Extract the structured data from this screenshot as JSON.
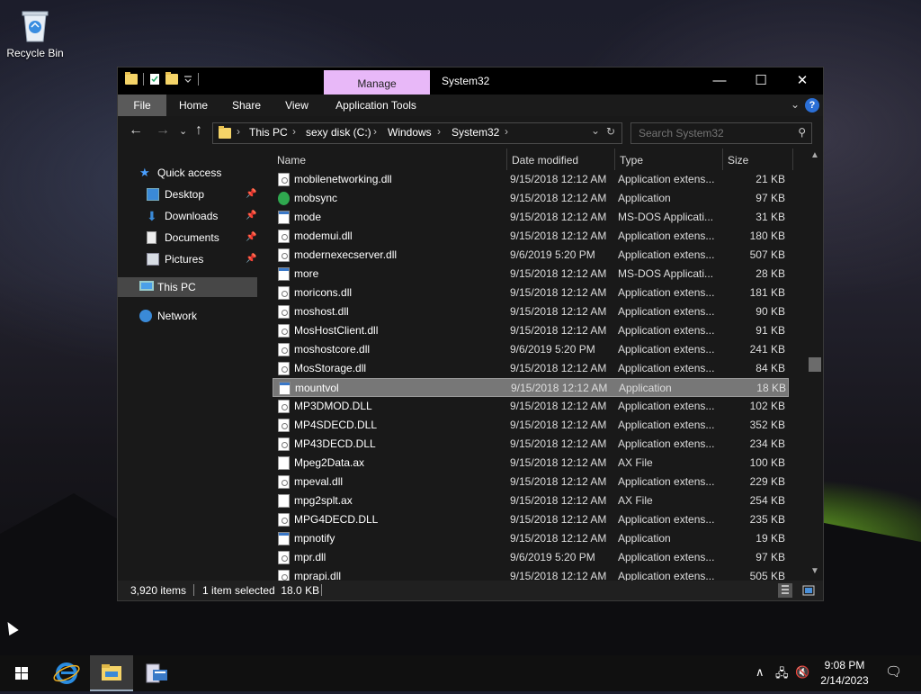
{
  "desktop": {
    "recycle_bin_label": "Recycle Bin"
  },
  "window": {
    "contextual_tab": "Manage",
    "title": "System32",
    "controls": {
      "minimize": "—",
      "maximize": "☐",
      "close": "✕"
    }
  },
  "ribbon": {
    "tabs": [
      "File",
      "Home",
      "Share",
      "View",
      "Application Tools"
    ]
  },
  "address": {
    "segments": [
      "This PC",
      "sexy disk (C:)",
      "Windows",
      "System32"
    ]
  },
  "search": {
    "placeholder": "Search System32"
  },
  "nav": {
    "items": [
      {
        "label": "Quick access",
        "icon": "star-icon"
      },
      {
        "label": "Desktop",
        "icon": "desktop-folder-icon",
        "pinned": true
      },
      {
        "label": "Downloads",
        "icon": "download-icon",
        "pinned": true
      },
      {
        "label": "Documents",
        "icon": "documents-icon",
        "pinned": true
      },
      {
        "label": "Pictures",
        "icon": "pictures-icon",
        "pinned": true
      },
      {
        "label": "This PC",
        "icon": "computer-icon",
        "selected": true
      },
      {
        "label": "Network",
        "icon": "network-icon"
      }
    ]
  },
  "columns": {
    "name": "Name",
    "date": "Date modified",
    "type": "Type",
    "size": "Size"
  },
  "files": [
    {
      "name": "mobilenetworking.dll",
      "date": "9/15/2018 12:12 AM",
      "type": "Application extens...",
      "size": "21 KB",
      "icon": "dll"
    },
    {
      "name": "mobsync",
      "date": "9/15/2018 12:12 AM",
      "type": "Application",
      "size": "97 KB",
      "icon": "sync"
    },
    {
      "name": "mode",
      "date": "9/15/2018 12:12 AM",
      "type": "MS-DOS Applicati...",
      "size": "31 KB",
      "icon": "app"
    },
    {
      "name": "modemui.dll",
      "date": "9/15/2018 12:12 AM",
      "type": "Application extens...",
      "size": "180 KB",
      "icon": "dll"
    },
    {
      "name": "modernexecserver.dll",
      "date": "9/6/2019 5:20 PM",
      "type": "Application extens...",
      "size": "507 KB",
      "icon": "dll"
    },
    {
      "name": "more",
      "date": "9/15/2018 12:12 AM",
      "type": "MS-DOS Applicati...",
      "size": "28 KB",
      "icon": "app"
    },
    {
      "name": "moricons.dll",
      "date": "9/15/2018 12:12 AM",
      "type": "Application extens...",
      "size": "181 KB",
      "icon": "dll"
    },
    {
      "name": "moshost.dll",
      "date": "9/15/2018 12:12 AM",
      "type": "Application extens...",
      "size": "90 KB",
      "icon": "dll"
    },
    {
      "name": "MosHostClient.dll",
      "date": "9/15/2018 12:12 AM",
      "type": "Application extens...",
      "size": "91 KB",
      "icon": "dll"
    },
    {
      "name": "moshostcore.dll",
      "date": "9/6/2019 5:20 PM",
      "type": "Application extens...",
      "size": "241 KB",
      "icon": "dll"
    },
    {
      "name": "MosStorage.dll",
      "date": "9/15/2018 12:12 AM",
      "type": "Application extens...",
      "size": "84 KB",
      "icon": "dll"
    },
    {
      "name": "mountvol",
      "date": "9/15/2018 12:12 AM",
      "type": "Application",
      "size": "18 KB",
      "icon": "app",
      "selected": true
    },
    {
      "name": "MP3DMOD.DLL",
      "date": "9/15/2018 12:12 AM",
      "type": "Application extens...",
      "size": "102 KB",
      "icon": "dll"
    },
    {
      "name": "MP4SDECD.DLL",
      "date": "9/15/2018 12:12 AM",
      "type": "Application extens...",
      "size": "352 KB",
      "icon": "dll"
    },
    {
      "name": "MP43DECD.DLL",
      "date": "9/15/2018 12:12 AM",
      "type": "Application extens...",
      "size": "234 KB",
      "icon": "dll"
    },
    {
      "name": "Mpeg2Data.ax",
      "date": "9/15/2018 12:12 AM",
      "type": "AX File",
      "size": "100 KB",
      "icon": "ax"
    },
    {
      "name": "mpeval.dll",
      "date": "9/15/2018 12:12 AM",
      "type": "Application extens...",
      "size": "229 KB",
      "icon": "dll"
    },
    {
      "name": "mpg2splt.ax",
      "date": "9/15/2018 12:12 AM",
      "type": "AX File",
      "size": "254 KB",
      "icon": "ax"
    },
    {
      "name": "MPG4DECD.DLL",
      "date": "9/15/2018 12:12 AM",
      "type": "Application extens...",
      "size": "235 KB",
      "icon": "dll"
    },
    {
      "name": "mpnotify",
      "date": "9/15/2018 12:12 AM",
      "type": "Application",
      "size": "19 KB",
      "icon": "app"
    },
    {
      "name": "mpr.dll",
      "date": "9/6/2019 5:20 PM",
      "type": "Application extens...",
      "size": "97 KB",
      "icon": "dll"
    },
    {
      "name": "mprapi.dll",
      "date": "9/15/2018 12:12 AM",
      "type": "Application extens...",
      "size": "505 KB",
      "icon": "dll"
    }
  ],
  "status": {
    "item_count": "3,920 items",
    "selection": "1 item selected  18.0 KB"
  },
  "taskbar": {
    "time": "9:08 PM",
    "date": "2/14/2023"
  }
}
